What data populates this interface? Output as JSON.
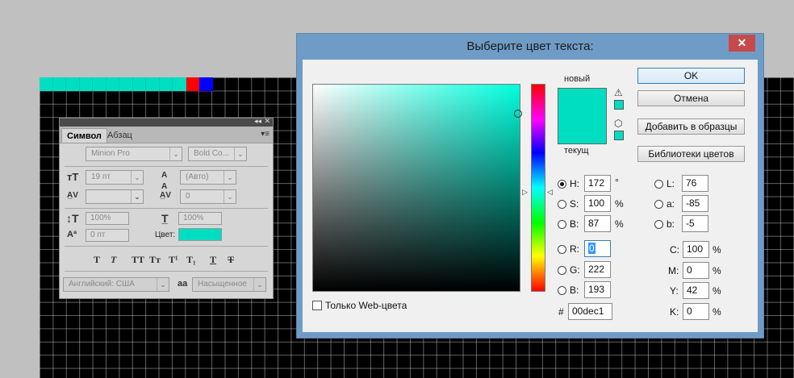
{
  "swatch_strip": {
    "colors": [
      "#00dec1",
      "#00dec1",
      "#00dec1",
      "#00dec1",
      "#00dec1",
      "#00dec1",
      "#00dec1",
      "#00dec1",
      "#00dec1",
      "#00dec1",
      "#00dec1",
      "#ff0000",
      "#0000ff"
    ]
  },
  "character_panel": {
    "tab_active": "Символ",
    "tab_inactive": "Абзац",
    "collapse_glyph": "◂◂",
    "close_glyph": "✕",
    "menu_glyph": "▾≡",
    "font_family": "Minion Pro",
    "font_style": "Bold Co...",
    "font_size": "19 пт",
    "leading": "(Авто)",
    "kerning": "",
    "tracking": "0",
    "vertical_scale": "100%",
    "horizontal_scale": "100%",
    "baseline_shift": "0 пт",
    "color_label": "Цвет:",
    "color_value": "#00dec1",
    "language": "Английский: США",
    "antialias": "Насыщенное",
    "antialias_icon_text": "aa",
    "style_buttons": [
      "T",
      "T",
      "TT",
      "Tт",
      "T¹",
      "T₁",
      "T",
      "T"
    ]
  },
  "color_dialog": {
    "title": "Выберите цвет текста:",
    "close_glyph": "✕",
    "new_label": "новый",
    "current_label": "текущ",
    "new_color": "#00dec1",
    "current_color": "#00dec1",
    "buttons": {
      "ok": "OK",
      "cancel": "Отмена",
      "add_swatch": "Добавить в образцы",
      "libraries": "Библиотеки цветов"
    },
    "hsb": {
      "h_label": "H:",
      "h": "172",
      "h_unit": "°",
      "s_label": "S:",
      "s": "100",
      "s_unit": "%",
      "b_label": "B:",
      "b": "87",
      "b_unit": "%"
    },
    "rgb": {
      "r_label": "R:",
      "r": "0",
      "g_label": "G:",
      "g": "222",
      "b_label": "B:",
      "b": "193"
    },
    "lab": {
      "l_label": "L:",
      "l": "76",
      "a_label": "a:",
      "a": "-85",
      "b_label": "b:",
      "b": "-5"
    },
    "cmyk": {
      "c_label": "C:",
      "c": "100",
      "m_label": "M:",
      "m": "0",
      "y_label": "Y:",
      "y": "42",
      "k_label": "K:",
      "k": "0",
      "unit": "%"
    },
    "hex_label": "#",
    "hex": "00dec1",
    "web_only_label": "Только Web-цвета",
    "gamut_warning_icon": "warning-triangle-icon",
    "web_safe_icon": "cube-icon",
    "selected_mode": "H"
  }
}
